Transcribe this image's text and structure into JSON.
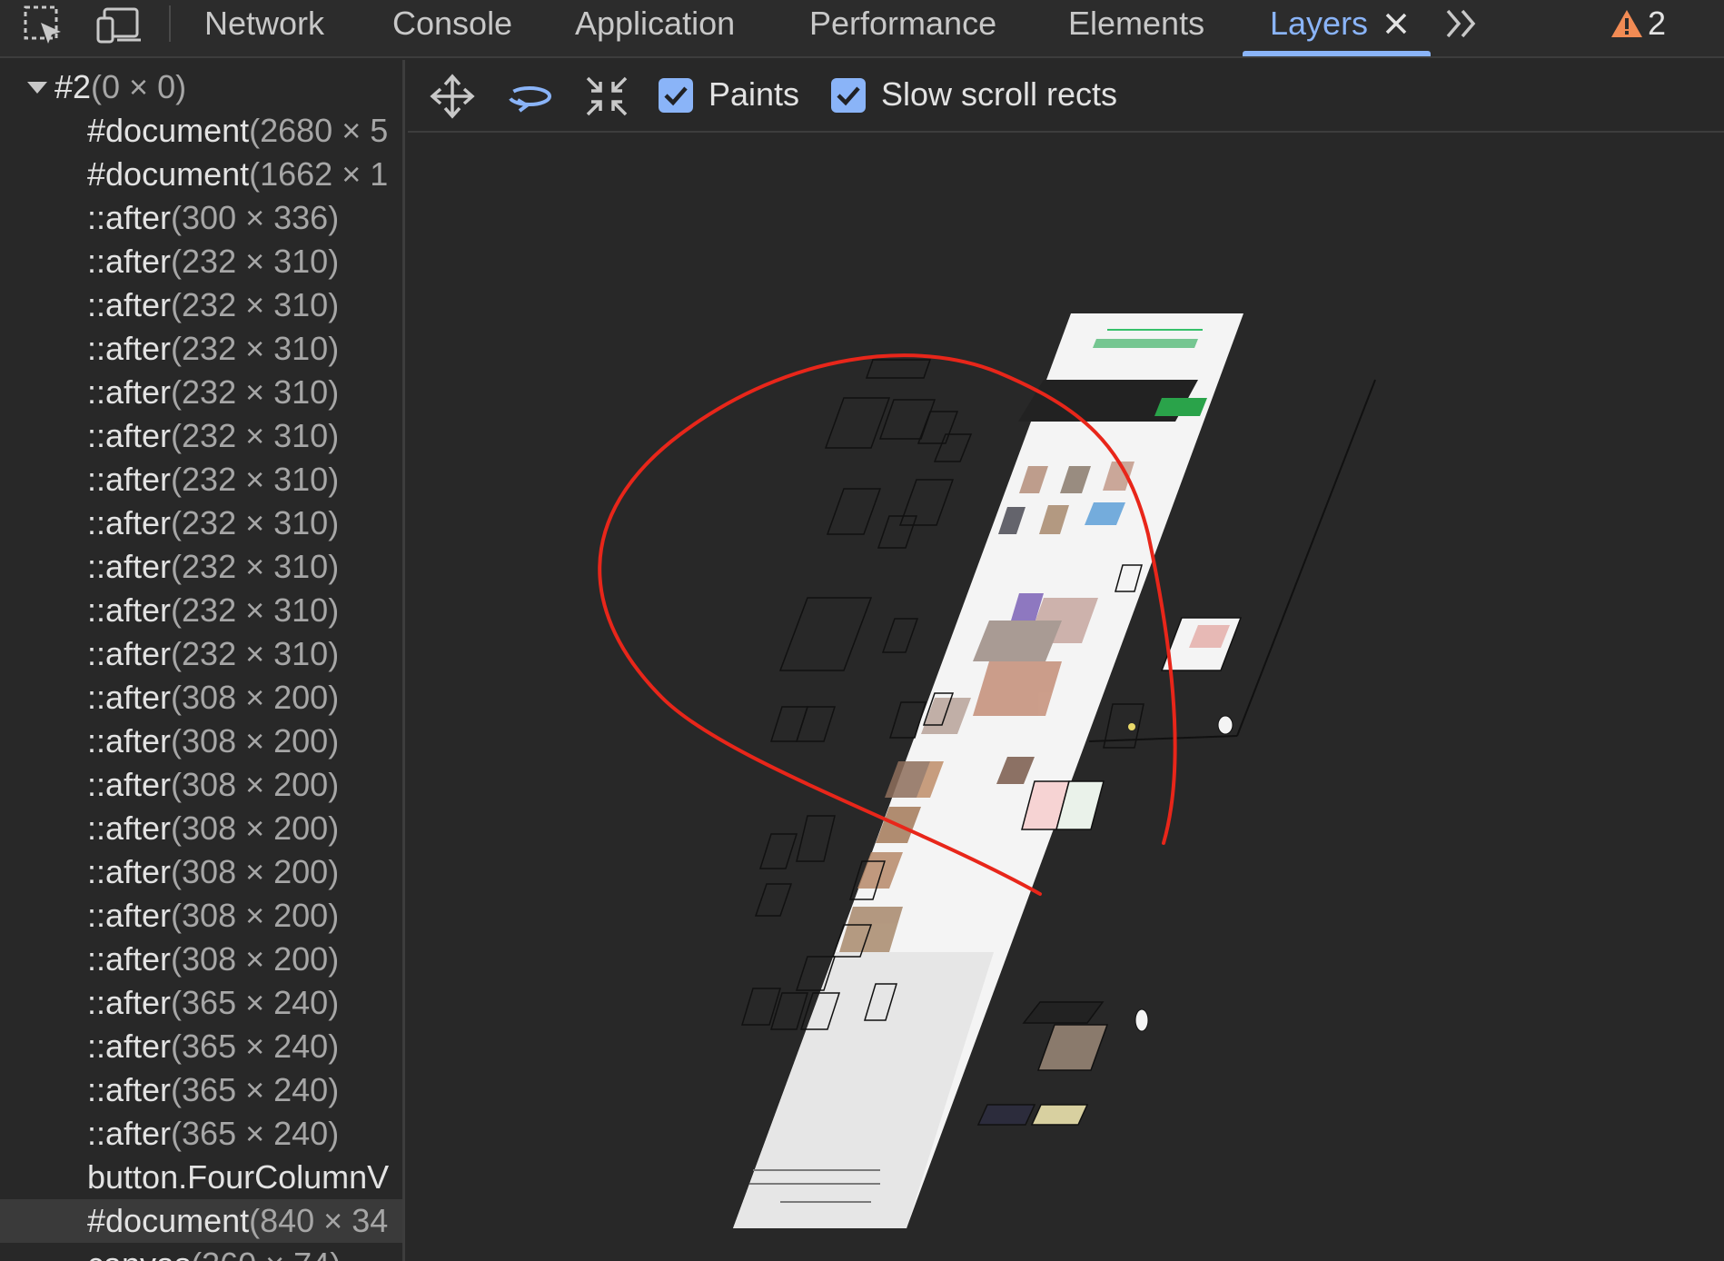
{
  "toolbar": {
    "tabs": [
      {
        "label": "Network",
        "active": false
      },
      {
        "label": "Console",
        "active": false
      },
      {
        "label": "Application",
        "active": false
      },
      {
        "label": "Performance",
        "active": false
      },
      {
        "label": "Elements",
        "active": false
      },
      {
        "label": "Layers",
        "active": true
      }
    ],
    "warning_count": "2",
    "icons": {
      "inspect": "inspect-element-icon",
      "device": "device-toggle-icon",
      "close": "close-icon",
      "more": "chevron-double-right-icon",
      "warning": "warning-triangle-icon"
    }
  },
  "tree": {
    "root": {
      "name": "#2",
      "dims": "(0 × 0)"
    },
    "items": [
      {
        "name": "#document",
        "dims": "(2680 × 5"
      },
      {
        "name": "#document",
        "dims": "(1662 × 1"
      },
      {
        "name": "::after",
        "dims": "(300 × 336)"
      },
      {
        "name": "::after",
        "dims": "(232 × 310)"
      },
      {
        "name": "::after",
        "dims": "(232 × 310)"
      },
      {
        "name": "::after",
        "dims": "(232 × 310)"
      },
      {
        "name": "::after",
        "dims": "(232 × 310)"
      },
      {
        "name": "::after",
        "dims": "(232 × 310)"
      },
      {
        "name": "::after",
        "dims": "(232 × 310)"
      },
      {
        "name": "::after",
        "dims": "(232 × 310)"
      },
      {
        "name": "::after",
        "dims": "(232 × 310)"
      },
      {
        "name": "::after",
        "dims": "(232 × 310)"
      },
      {
        "name": "::after",
        "dims": "(232 × 310)"
      },
      {
        "name": "::after",
        "dims": "(308 × 200)"
      },
      {
        "name": "::after",
        "dims": "(308 × 200)"
      },
      {
        "name": "::after",
        "dims": "(308 × 200)"
      },
      {
        "name": "::after",
        "dims": "(308 × 200)"
      },
      {
        "name": "::after",
        "dims": "(308 × 200)"
      },
      {
        "name": "::after",
        "dims": "(308 × 200)"
      },
      {
        "name": "::after",
        "dims": "(308 × 200)"
      },
      {
        "name": "::after",
        "dims": "(365 × 240)"
      },
      {
        "name": "::after",
        "dims": "(365 × 240)"
      },
      {
        "name": "::after",
        "dims": "(365 × 240)"
      },
      {
        "name": "::after",
        "dims": "(365 × 240)"
      },
      {
        "name": "button.FourColumnV",
        "dims": ""
      },
      {
        "name": "#document",
        "dims": "(840 × 34",
        "selected": true
      },
      {
        "name": "canvas",
        "dims": "(360 × 74)"
      }
    ]
  },
  "viewer": {
    "tools": [
      "pan-mode-icon",
      "rotate-mode-icon",
      "reset-transform-icon"
    ],
    "checkboxes": [
      {
        "label": "Paints",
        "checked": true
      },
      {
        "label": "Slow scroll rects",
        "checked": true
      }
    ]
  },
  "colors": {
    "accent": "#8ab4f8",
    "background": "#282828",
    "annotation": "#e8261a",
    "warning": "#f28b54"
  }
}
